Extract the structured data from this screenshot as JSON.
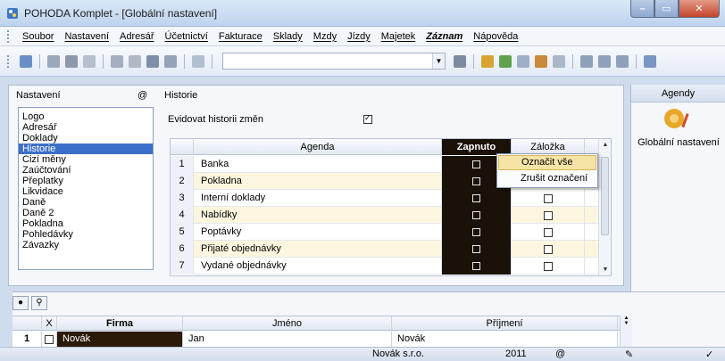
{
  "window": {
    "title": "POHODA Komplet - [Globální nastavení]",
    "minimize": "–",
    "maximize": "▭",
    "close": "✕"
  },
  "menu": {
    "items": [
      "Soubor",
      "Nastavení",
      "Adresář",
      "Účetnictví",
      "Fakturace",
      "Sklady",
      "Mzdy",
      "Jízdy",
      "Majetek",
      "Záznam",
      "Nápověda"
    ]
  },
  "settings": {
    "group_label": "Nastavení",
    "at_symbol": "@",
    "items": [
      "Logo",
      "Adresář",
      "Doklady",
      "Historie",
      "Cizí měny",
      "Zaúčtování",
      "Přeplatky",
      "Likvidace",
      "Daně",
      "Daně 2",
      "Pokladna",
      "Pohledávky",
      "Závazky"
    ],
    "selected_index": 3
  },
  "history": {
    "group_label": "Historie",
    "track_label": "Evidovat historii změn",
    "track_checked": true,
    "columns": {
      "agenda": "Agenda",
      "enabled": "Zapnuto",
      "tab": "Záložka"
    },
    "rows": [
      {
        "num": "1",
        "agenda": "Banka"
      },
      {
        "num": "2",
        "agenda": "Pokladna"
      },
      {
        "num": "3",
        "agenda": "Interní doklady"
      },
      {
        "num": "4",
        "agenda": "Nabídky"
      },
      {
        "num": "5",
        "agenda": "Poptávky"
      },
      {
        "num": "6",
        "agenda": "Přijaté objednávky"
      },
      {
        "num": "7",
        "agenda": "Vydané objednávky"
      }
    ]
  },
  "context_menu": {
    "select_all": "Označit vše",
    "deselect": "Zrušit označení"
  },
  "agendy": {
    "title": "Agendy",
    "item_label": "Globální nastavení"
  },
  "bottom_table": {
    "columns": {
      "x": "X",
      "firma": "Firma",
      "jmeno": "Jméno",
      "prijmeni": "Příjmení"
    },
    "row": {
      "num": "1",
      "firma": "Novák",
      "jmeno": "Jan",
      "prijmeni": "Novák"
    }
  },
  "status": {
    "company": "Novák s.r.o.",
    "year": "2011",
    "at": "@"
  }
}
